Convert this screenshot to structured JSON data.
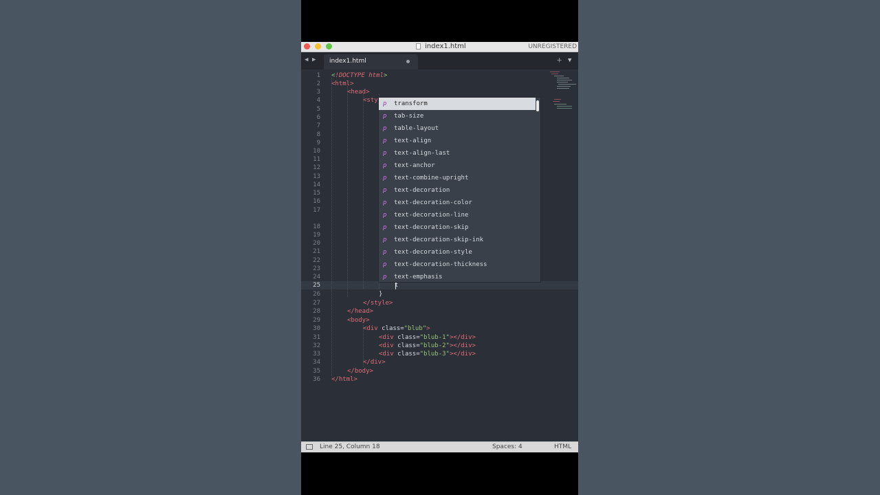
{
  "window": {
    "title": "index1.html",
    "unregistered_label": "UNREGISTERED"
  },
  "tabs": [
    {
      "label": "index1.html",
      "dirty": true
    }
  ],
  "code_lines": [
    {
      "n": "1",
      "text": ""
    },
    {
      "n": "2",
      "text": ""
    },
    {
      "n": "3",
      "text": ""
    },
    {
      "n": "4",
      "text": ""
    },
    {
      "n": "5",
      "text": ""
    },
    {
      "n": "6",
      "text": ""
    },
    {
      "n": "7",
      "text": ""
    },
    {
      "n": "8",
      "text": ""
    },
    {
      "n": "9",
      "text": ""
    },
    {
      "n": "10",
      "text": ""
    },
    {
      "n": "11",
      "text": ""
    },
    {
      "n": "12",
      "text": ""
    },
    {
      "n": "13",
      "text": ""
    },
    {
      "n": "14",
      "text": ""
    },
    {
      "n": "15",
      "text": ""
    },
    {
      "n": "16",
      "text": ""
    },
    {
      "n": "17",
      "text": ""
    },
    {
      "n": "18",
      "text": ""
    },
    {
      "n": "19",
      "text": ""
    },
    {
      "n": "20",
      "text": ""
    },
    {
      "n": "21",
      "text": ""
    },
    {
      "n": "22",
      "text": ""
    },
    {
      "n": "23",
      "text": ""
    },
    {
      "n": "24",
      "text": ""
    },
    {
      "n": "25",
      "text": ""
    },
    {
      "n": "26",
      "text": ""
    },
    {
      "n": "27",
      "text": ""
    },
    {
      "n": "28",
      "text": ""
    },
    {
      "n": "29",
      "text": ""
    },
    {
      "n": "30",
      "text": ""
    },
    {
      "n": "31",
      "text": ""
    },
    {
      "n": "32",
      "text": ""
    },
    {
      "n": "33",
      "text": ""
    },
    {
      "n": "34",
      "text": ""
    },
    {
      "n": "35",
      "text": ""
    },
    {
      "n": "36",
      "text": ""
    }
  ],
  "code": {
    "l1_open": "<",
    "l1_doctype": "!DOCTYPE",
    "l1_html": "html",
    "l1_close": ">",
    "l2": "<html>",
    "l3": "<head>",
    "l4": "<sty",
    "l25_typed": "t",
    "l26": "}",
    "l27": "</style>",
    "l28": "</head>",
    "l29": "<body>",
    "l30_open": "<div",
    "l30_attr": " class=",
    "l30_val": "\"blub\"",
    "l30_end": ">",
    "l31_open": "<div",
    "l31_attr": " class=",
    "l31_val": "\"blub-1\"",
    "l31_end": "></div>",
    "l32_open": "<div",
    "l32_attr": " class=",
    "l32_val": "\"blub-2\"",
    "l32_end": "></div>",
    "l33_open": "<div",
    "l33_attr": " class=",
    "l33_val": "\"blub-3\"",
    "l33_end": "></div>",
    "l34": "</div>",
    "l35": "</body>",
    "l36": "</html>"
  },
  "autocomplete": {
    "kind_letter": "p",
    "items": [
      "transform",
      "tab-size",
      "table-layout",
      "text-align",
      "text-align-last",
      "text-anchor",
      "text-combine-upright",
      "text-decoration",
      "text-decoration-color",
      "text-decoration-line",
      "text-decoration-skip",
      "text-decoration-skip-ink",
      "text-decoration-style",
      "text-decoration-thickness",
      "text-emphasis"
    ],
    "selected_index": 0
  },
  "statusbar": {
    "position": "Line 25, Column 18",
    "spaces": "Spaces: 4",
    "syntax": "HTML"
  },
  "icons": {
    "nav_left": "triangle-left-icon",
    "nav_right": "triangle-right-icon",
    "new_tab": "plus-icon",
    "tab_menu": "chevron-down-icon",
    "file": "document-icon",
    "sidebar_toggle": "panel-icon"
  }
}
